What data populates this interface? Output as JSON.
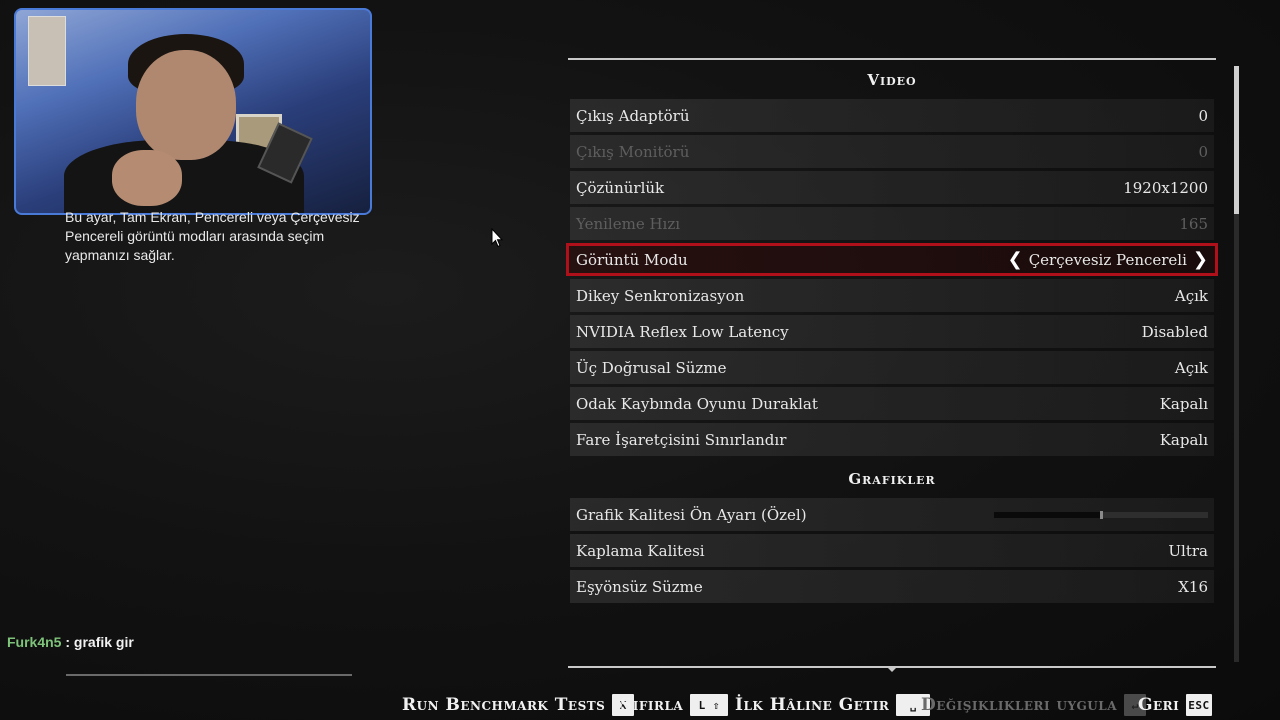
{
  "help_text": "Bu ayar, Tam Ekran, Pencereli veya Çerçevesiz Pencereli görüntü modları arasında seçim yapmanızı sağlar.",
  "chat": {
    "user": "Furk4n5",
    "separator": ":",
    "message": "grafik gir"
  },
  "video": {
    "title": "Video",
    "rows": [
      {
        "label": "Çıkış Adaptörü",
        "value": "0"
      },
      {
        "label": "Çıkış Monitörü",
        "value": "0"
      },
      {
        "label": "Çözünürlük",
        "value": "1920x1200"
      },
      {
        "label": "Yenileme Hızı",
        "value": "165"
      },
      {
        "label": "Görüntü Modu",
        "value": "Çerçevesiz Pencereli"
      },
      {
        "label": "Dikey Senkronizasyon",
        "value": "Açık"
      },
      {
        "label": "NVIDIA Reflex Low Latency",
        "value": "Disabled"
      },
      {
        "label": "Üç Doğrusal Süzme",
        "value": "Açık"
      },
      {
        "label": "Odak Kaybında Oyunu Duraklat",
        "value": "Kapalı"
      },
      {
        "label": "Fare İşaretçisini Sınırlandır",
        "value": "Kapalı"
      }
    ]
  },
  "graphics": {
    "title": "Grafikler",
    "rows": [
      {
        "label": "Grafik Kalitesi Ön Ayarı  (Özel)",
        "slider_level": 0.5
      },
      {
        "label": "Kaplama Kalitesi",
        "value": "Ultra"
      },
      {
        "label": "Eşyönsüz Süzme",
        "value": "X16"
      }
    ]
  },
  "footer": {
    "benchmark": {
      "label": "Run Benchmark Tests",
      "key": "X"
    },
    "reset": {
      "label": "Sıfırla",
      "key": "L ⇧"
    },
    "restore": {
      "label": "İlk Hâline Getir",
      "key": "␣"
    },
    "apply": {
      "label": "Değişiklikleri uygula",
      "key": "↵"
    },
    "back": {
      "label": "Geri",
      "key": "ESC"
    }
  },
  "colors": {
    "selection_border": "#b0101a",
    "disabled_text": "#5e5e5e",
    "webcam_border": "#4a7ad8"
  }
}
